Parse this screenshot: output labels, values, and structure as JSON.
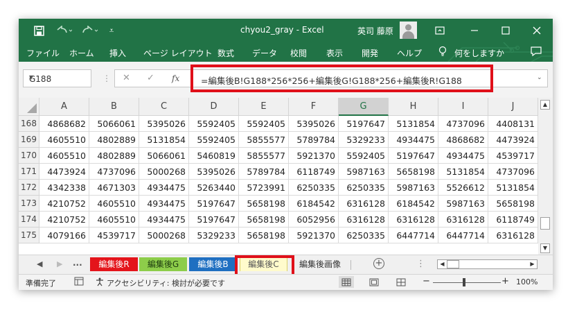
{
  "titlebar": {
    "title": "chyou2_gray  -  Excel",
    "user": "英司 藤原",
    "icons": [
      "save-icon",
      "undo-icon",
      "redo-icon",
      "customize-icon",
      "ribbon-display-icon",
      "minimize-icon",
      "maximize-icon",
      "close-icon"
    ]
  },
  "menu": {
    "items": [
      "ファイル",
      "ホーム",
      "挿入",
      "ページ レイアウト",
      "数式",
      "データ",
      "校閲",
      "表示",
      "開発",
      "ヘルプ",
      "何をしますか"
    ]
  },
  "formula_bar": {
    "name_box": "G188",
    "cancel": "✕",
    "enter": "✓",
    "fx": "fx",
    "formula": "=編集後B!G188*256*256+編集後G!G188*256+編集後R!G188"
  },
  "grid": {
    "columns": [
      "A",
      "B",
      "C",
      "D",
      "E",
      "F",
      "G",
      "H",
      "I",
      "J"
    ],
    "selected_column": "G",
    "rows": [
      {
        "num": "168",
        "cells": [
          "4868682",
          "5066061",
          "5395026",
          "5592405",
          "5592405",
          "5395026",
          "5197647",
          "5131854",
          "4737096",
          "4408131"
        ]
      },
      {
        "num": "169",
        "cells": [
          "4605510",
          "4802889",
          "5131854",
          "5592405",
          "5855577",
          "5789784",
          "5329233",
          "4934475",
          "4868682",
          "4473924"
        ]
      },
      {
        "num": "170",
        "cells": [
          "4605510",
          "4802889",
          "5066061",
          "5460819",
          "5855577",
          "5921370",
          "5592405",
          "5197647",
          "4934475",
          "4539717"
        ]
      },
      {
        "num": "171",
        "cells": [
          "4473924",
          "4737096",
          "5000268",
          "5395026",
          "5789784",
          "6118749",
          "5987163",
          "5658198",
          "5131854",
          "4737096"
        ]
      },
      {
        "num": "172",
        "cells": [
          "4342338",
          "4671303",
          "4934475",
          "5263440",
          "5723991",
          "6250335",
          "6250335",
          "5987163",
          "5526612",
          "5131854"
        ]
      },
      {
        "num": "173",
        "cells": [
          "4210752",
          "4605510",
          "4934475",
          "5197647",
          "5658198",
          "6184542",
          "6316128",
          "6184542",
          "5987163",
          "5658198"
        ]
      },
      {
        "num": "174",
        "cells": [
          "4210752",
          "4605510",
          "4934475",
          "5197647",
          "5658198",
          "6052956",
          "6316128",
          "6316128",
          "6316128",
          "6118749"
        ]
      },
      {
        "num": "175",
        "cells": [
          "4079166",
          "4539717",
          "5000268",
          "5329233",
          "5658198",
          "5921370",
          "6250335",
          "6447714",
          "6447714",
          "6316128"
        ]
      }
    ]
  },
  "sheet_tabs": {
    "more": "...",
    "tabs": [
      "編集後R",
      "編集後G",
      "編集後B",
      "編集後C",
      "編集後画像"
    ],
    "active": "編集後C",
    "tab_colors": {
      "編集後R": "#e4141b",
      "編集後G": "#8dcd4a",
      "編集後B": "#1f6fc1",
      "編集後C": "#fffbcc"
    }
  },
  "status": {
    "ready": "準備完了",
    "accessibility": "アクセシビリティ: 検討が必要です",
    "zoom_minus": "−",
    "zoom_plus": "+",
    "zoom": "100%"
  },
  "colors": {
    "excel_green": "#217346",
    "highlight_red": "#e0101a"
  }
}
